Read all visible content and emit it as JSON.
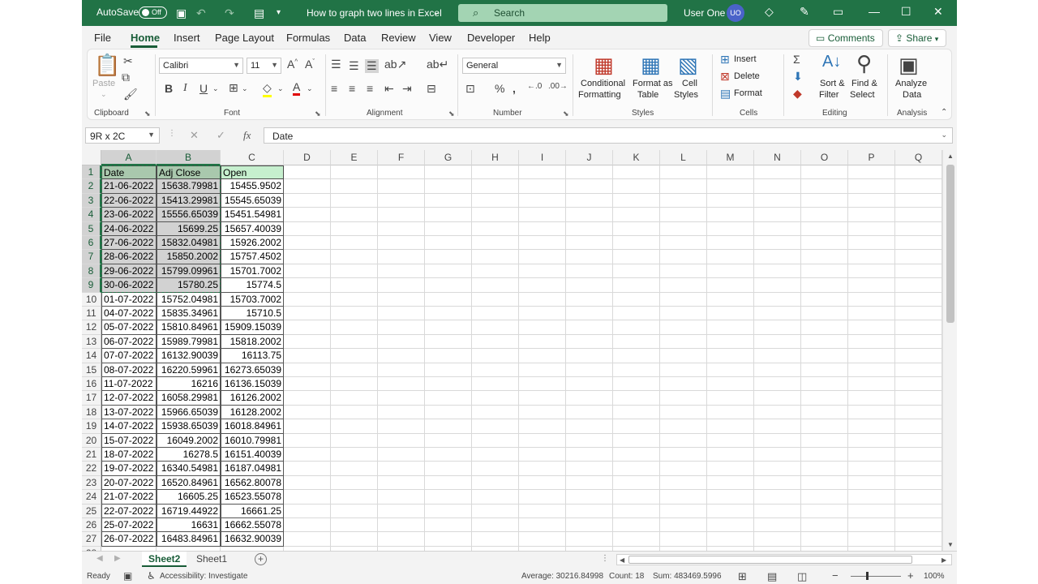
{
  "titlebar": {
    "autosave": "AutoSave",
    "autosave_state": "Off",
    "doc_title": "How to graph two lines in Excel",
    "search_placeholder": "Search",
    "user": "User One",
    "initials": "UO"
  },
  "tabs": [
    "File",
    "Home",
    "Insert",
    "Page Layout",
    "Formulas",
    "Data",
    "Review",
    "View",
    "Developer",
    "Help"
  ],
  "comments_label": "Comments",
  "share_label": "Share",
  "ribbon": {
    "clipboard": {
      "label": "Clipboard",
      "paste": "Paste"
    },
    "font": {
      "label": "Font",
      "name": "Calibri",
      "size": "11"
    },
    "alignment": {
      "label": "Alignment"
    },
    "number": {
      "label": "Number",
      "format": "General"
    },
    "styles": {
      "label": "Styles",
      "cond1": "Conditional",
      "cond2": "Formatting",
      "fmt1": "Format as",
      "fmt2": "Table",
      "cell1": "Cell",
      "cell2": "Styles"
    },
    "cells": {
      "label": "Cells",
      "insert": "Insert",
      "delete": "Delete",
      "format": "Format"
    },
    "editing": {
      "label": "Editing",
      "sort1": "Sort &",
      "sort2": "Filter",
      "find1": "Find &",
      "find2": "Select"
    },
    "analysis": {
      "label": "Analysis",
      "an1": "Analyze",
      "an2": "Data"
    }
  },
  "formula_bar": {
    "name_box": "9R x 2C",
    "fx": "fx",
    "content": "Date"
  },
  "columns": [
    "A",
    "B",
    "C",
    "D",
    "E",
    "F",
    "G",
    "H",
    "I",
    "J",
    "K",
    "L",
    "M",
    "N",
    "O",
    "P",
    "Q"
  ],
  "headers": [
    "Date",
    "Adj Close",
    "Open"
  ],
  "rows": [
    [
      "21-06-2022",
      "15638.79981",
      "15455.9502"
    ],
    [
      "22-06-2022",
      "15413.29981",
      "15545.65039"
    ],
    [
      "23-06-2022",
      "15556.65039",
      "15451.54981"
    ],
    [
      "24-06-2022",
      "15699.25",
      "15657.40039"
    ],
    [
      "27-06-2022",
      "15832.04981",
      "15926.2002"
    ],
    [
      "28-06-2022",
      "15850.2002",
      "15757.4502"
    ],
    [
      "29-06-2022",
      "15799.09961",
      "15701.7002"
    ],
    [
      "30-06-2022",
      "15780.25",
      "15774.5"
    ],
    [
      "01-07-2022",
      "15752.04981",
      "15703.7002"
    ],
    [
      "04-07-2022",
      "15835.34961",
      "15710.5"
    ],
    [
      "05-07-2022",
      "15810.84961",
      "15909.15039"
    ],
    [
      "06-07-2022",
      "15989.79981",
      "15818.2002"
    ],
    [
      "07-07-2022",
      "16132.90039",
      "16113.75"
    ],
    [
      "08-07-2022",
      "16220.59961",
      "16273.65039"
    ],
    [
      "11-07-2022",
      "16216",
      "16136.15039"
    ],
    [
      "12-07-2022",
      "16058.29981",
      "16126.2002"
    ],
    [
      "13-07-2022",
      "15966.65039",
      "16128.2002"
    ],
    [
      "14-07-2022",
      "15938.65039",
      "16018.84961"
    ],
    [
      "15-07-2022",
      "16049.2002",
      "16010.79981"
    ],
    [
      "18-07-2022",
      "16278.5",
      "16151.40039"
    ],
    [
      "19-07-2022",
      "16340.54981",
      "16187.04981"
    ],
    [
      "20-07-2022",
      "16520.84961",
      "16562.80078"
    ],
    [
      "21-07-2022",
      "16605.25",
      "16523.55078"
    ],
    [
      "22-07-2022",
      "16719.44922",
      "16661.25"
    ],
    [
      "25-07-2022",
      "16631",
      "16662.55078"
    ],
    [
      "26-07-2022",
      "16483.84961",
      "16632.90039"
    ]
  ],
  "sheets": [
    "Sheet2",
    "Sheet1"
  ],
  "status": {
    "ready": "Ready",
    "accessibility": "Accessibility: Investigate",
    "average": "Average: 30216.84998",
    "count": "Count: 18",
    "sum": "Sum: 483469.5996",
    "zoom": "100%"
  }
}
